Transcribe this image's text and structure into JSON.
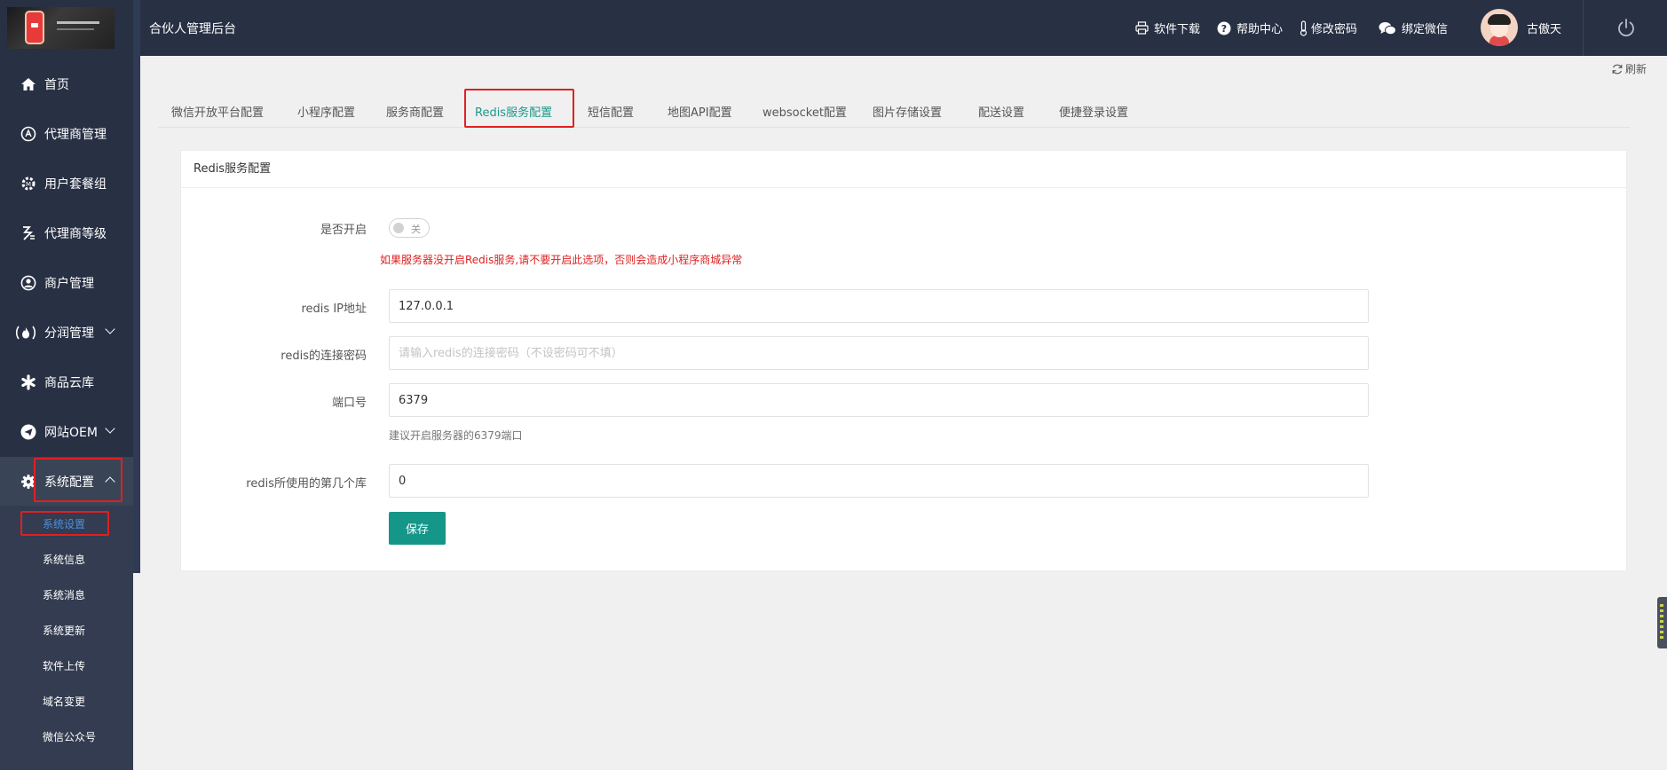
{
  "app": {
    "title": "合伙人管理后台"
  },
  "header": {
    "links": [
      {
        "label": "软件下载",
        "icon": "printer-icon"
      },
      {
        "label": "帮助中心",
        "icon": "help-icon"
      },
      {
        "label": "修改密码",
        "icon": "thermometer-icon"
      },
      {
        "label": "绑定微信",
        "icon": "wechat-icon"
      }
    ],
    "username": "古傲天"
  },
  "sidebar": {
    "items": [
      {
        "label": "首页",
        "icon": "home-icon"
      },
      {
        "label": "代理商管理",
        "icon": "agent-icon"
      },
      {
        "label": "用户套餐组",
        "icon": "package-icon"
      },
      {
        "label": "代理商等级",
        "icon": "level-icon"
      },
      {
        "label": "商户管理",
        "icon": "user-icon"
      },
      {
        "label": "分润管理",
        "icon": "fire-icon"
      },
      {
        "label": "商品云库",
        "icon": "asterisk-icon"
      },
      {
        "label": "网站OEM",
        "icon": "send-icon"
      },
      {
        "label": "系统配置",
        "icon": "gear-icon"
      }
    ],
    "sub_items": [
      "系统设置",
      "系统信息",
      "系统消息",
      "系统更新",
      "软件上传",
      "域名变更",
      "微信公众号"
    ]
  },
  "toolbar": {
    "refresh_label": "刷新"
  },
  "tabs": [
    "微信开放平台配置",
    "小程序配置",
    "服务商配置",
    "Redis服务配置",
    "短信配置",
    "地图API配置",
    "websocket配置",
    "图片存储设置",
    "配送设置",
    "便捷登录设置"
  ],
  "panel": {
    "title": "Redis服务配置"
  },
  "form": {
    "enable_label": "是否开启",
    "switch_text": "关",
    "warning": "如果服务器没开启Redis服务,请不要开启此选项，否则会造成小程序商城异常",
    "ip_label": "redis IP地址",
    "ip_value": "127.0.0.1",
    "password_label": "redis的连接密码",
    "password_placeholder": "请输入redis的连接密码（不设密码可不填）",
    "port_label": "端口号",
    "port_value": "6379",
    "port_hint": "建议开启服务器的6379端口",
    "db_label": "redis所使用的第几个库",
    "db_value": "0",
    "save_label": "保存"
  },
  "colors": {
    "sidebar_bg": "#283044",
    "accent": "#149688",
    "warning": "#e02020",
    "active_sub": "#4a90e2"
  }
}
